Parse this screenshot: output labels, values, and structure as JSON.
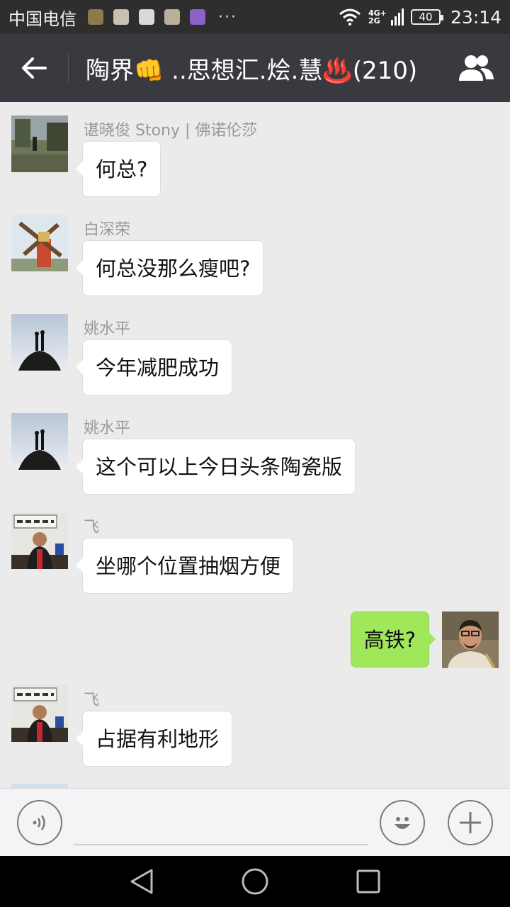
{
  "status_bar": {
    "carrier": "中国电信",
    "more": "···",
    "network": "4G+ 2G",
    "battery": "40",
    "time": "23:14"
  },
  "header": {
    "title": "陶界👊 ..思想汇.烩.慧♨️(210)"
  },
  "messages": [
    {
      "sender": "谌晓俊 Stony | 佛诺伦莎",
      "text": "何总?",
      "side": "left"
    },
    {
      "sender": "白深荣",
      "text": "何总没那么瘦吧?",
      "side": "left"
    },
    {
      "sender": "姚水平",
      "text": "今年减肥成功",
      "side": "left"
    },
    {
      "sender": "姚水平",
      "text": "这个可以上今日头条陶瓷版",
      "side": "left"
    },
    {
      "sender": "飞",
      "text": "坐哪个位置抽烟方便",
      "side": "left"
    },
    {
      "sender": "",
      "text": "高铁?",
      "side": "right"
    },
    {
      "sender": "飞",
      "text": "占据有利地形",
      "side": "left"
    }
  ],
  "colors": {
    "title_bar": "#393a3f",
    "chat_bg": "#ebebeb",
    "self_bubble": "#a0e75a"
  }
}
